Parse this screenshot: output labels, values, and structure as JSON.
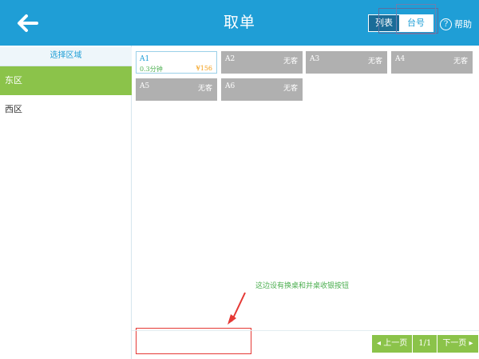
{
  "header": {
    "title": "取单",
    "view_list": "列表",
    "view_table_no": "台号",
    "help_label": "帮助",
    "help_glyph": "?"
  },
  "sidebar": {
    "title": "选择区域",
    "zones": [
      {
        "label": "东区",
        "selected": true
      },
      {
        "label": "西区",
        "selected": false
      }
    ]
  },
  "tables": [
    {
      "name": "A1",
      "time": "0.3分钟",
      "amount": "¥156",
      "active": true
    },
    {
      "name": "A2",
      "status": "无客"
    },
    {
      "name": "A3",
      "status": "无客"
    },
    {
      "name": "A4",
      "status": "无客"
    },
    {
      "name": "A5",
      "status": "无客"
    },
    {
      "name": "A6",
      "status": "无客"
    }
  ],
  "annotation": {
    "note": "这边设有换桌和并桌收银按钮"
  },
  "pager": {
    "prev": "上一页",
    "info": "1/1",
    "next": "下一页",
    "prev_glyph": "◂",
    "next_glyph": "▸"
  },
  "colors": {
    "header": "#1f9ed6",
    "selected_zone": "#8bc34a",
    "empty_table": "#b0b0b0",
    "annotation_red": "#e53935"
  }
}
